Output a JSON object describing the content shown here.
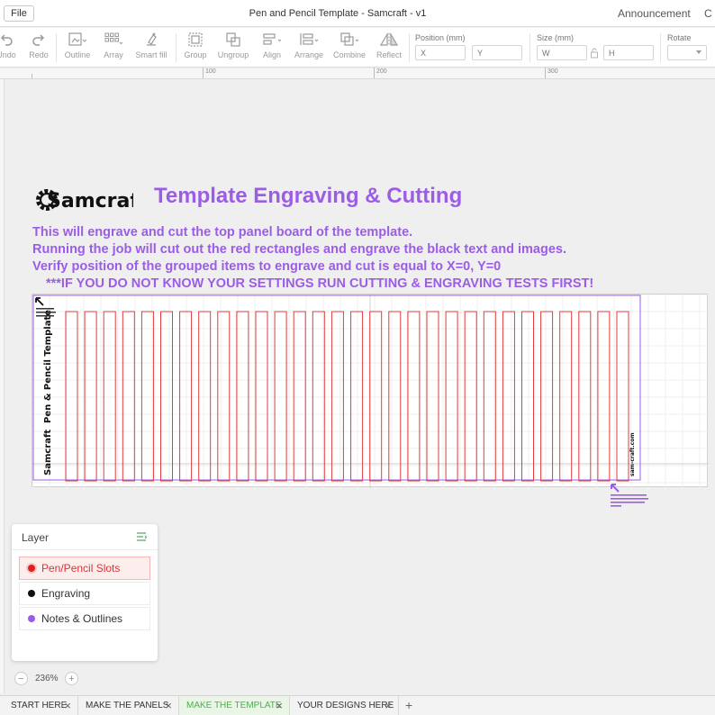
{
  "window": {
    "file_menu": "File",
    "title": "Pen and Pencil Template - Samcraft - v1",
    "announcement": "Announcement",
    "trailing": "C"
  },
  "toolbar": {
    "undo": "Undo",
    "redo": "Redo",
    "outline": "Outline",
    "array": "Array",
    "smart_fill": "Smart fill",
    "group": "Group",
    "ungroup": "Ungroup",
    "align": "Align",
    "arrange": "Arrange",
    "combine": "Combine",
    "reflect": "Reflect",
    "position_label": "Position (mm)",
    "x_placeholder": "X",
    "y_placeholder": "Y",
    "size_label": "Size (mm)",
    "w_placeholder": "W",
    "h_placeholder": "H",
    "rotate_label": "Rotate"
  },
  "ruler": {
    "marks": [
      "100",
      "200",
      "300"
    ]
  },
  "canvas": {
    "logo_text": "Samcraft",
    "heading": "Template Engraving & Cutting",
    "lines": [
      "This will engrave and cut the top panel board of the template.",
      "Running the job will cut out the red rectangles and engrave the black text and images.",
      "Verify position of the grouped items to engrave and cut is equal to X=0, Y=0",
      "***IF YOU DO NOT KNOW YOUR SETTINGS RUN CUTTING & ENGRAVING TESTS FIRST!"
    ],
    "board_title": "Pen & Pencil Template",
    "board_brand": "Samcraft",
    "website": "sam-craft.com",
    "slot_count": 30,
    "colors": {
      "accent": "#9b5de5",
      "cut": "#e23b3b",
      "engrave": "#111111"
    }
  },
  "layers": {
    "title": "Layer",
    "items": [
      {
        "label": "Pen/Pencil Slots",
        "color": "#e02020"
      },
      {
        "label": "Engraving",
        "color": "#111111"
      },
      {
        "label": "Notes & Outlines",
        "color": "#9b5de5"
      }
    ]
  },
  "zoom": {
    "level": "236%",
    "minus": "−",
    "plus": "+"
  },
  "tabs": [
    {
      "label": "START HERE"
    },
    {
      "label": "MAKE THE PANELS"
    },
    {
      "label": "MAKE THE TEMPLATE"
    },
    {
      "label": "YOUR DESIGNS HERE"
    }
  ],
  "tab_add": "+"
}
